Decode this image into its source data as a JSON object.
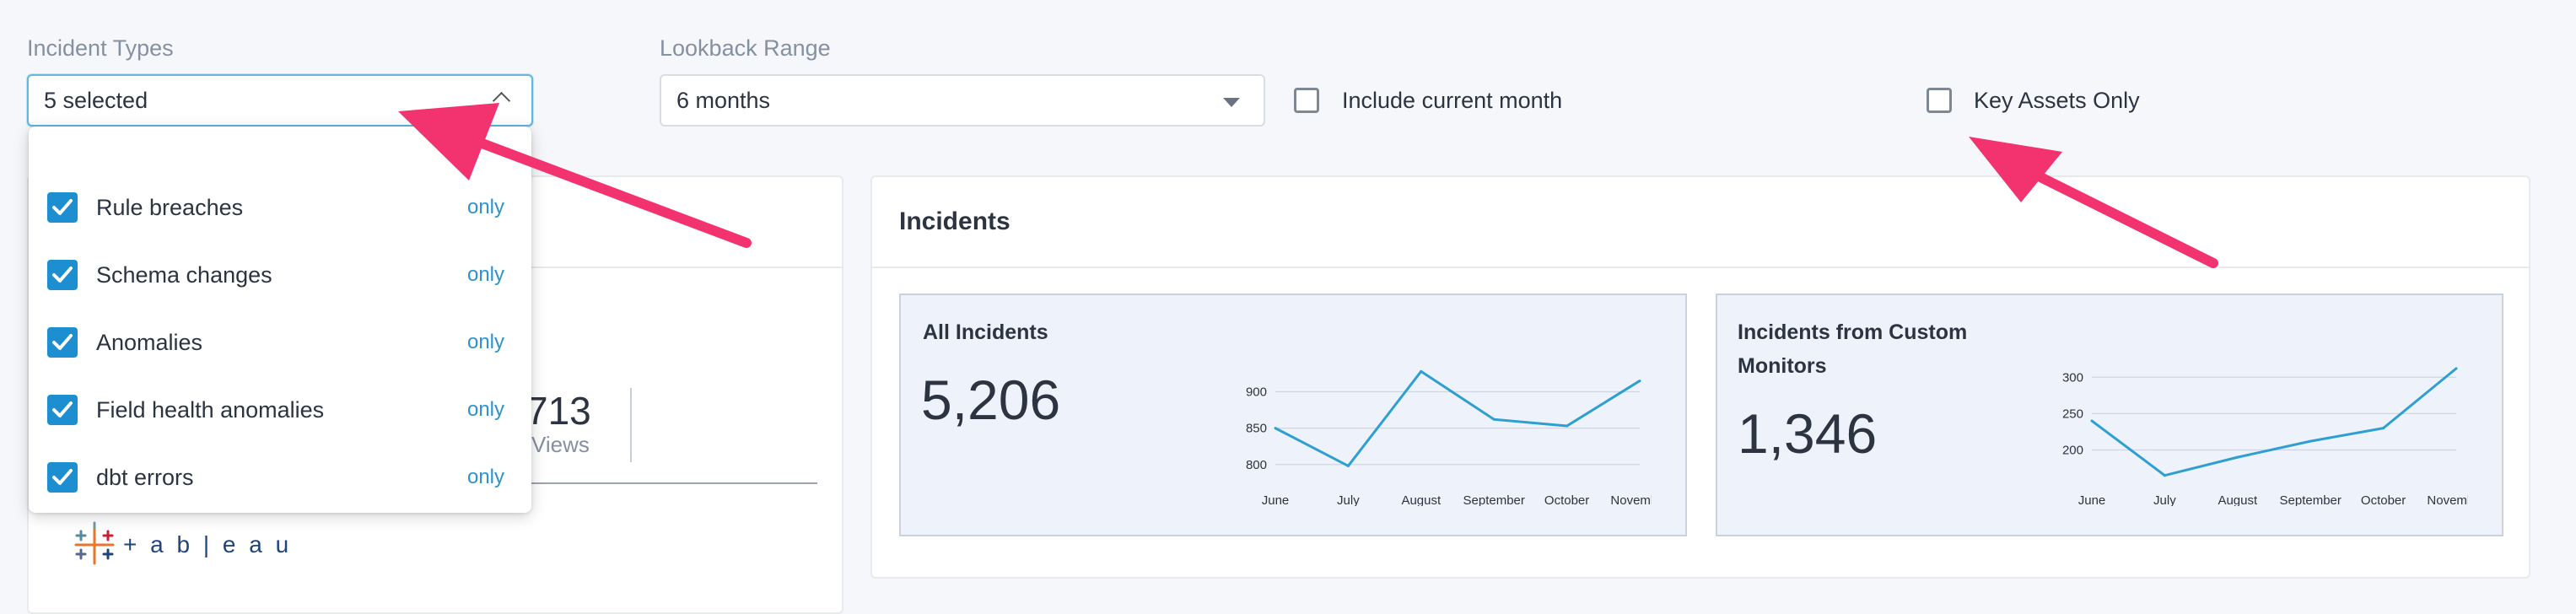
{
  "filters": {
    "incident_types": {
      "label": "Incident Types",
      "value": "5 selected"
    },
    "lookback_range": {
      "label": "Lookback Range",
      "value": "6 months"
    },
    "include_current_month": {
      "label": "Include current month",
      "checked": false
    },
    "key_assets_only": {
      "label": "Key Assets Only",
      "checked": false
    }
  },
  "dropdown": {
    "only_label": "only",
    "options": [
      {
        "label": "Rule breaches",
        "checked": true
      },
      {
        "label": "Schema changes",
        "checked": true
      },
      {
        "label": "Anomalies",
        "checked": true
      },
      {
        "label": "Field health anomalies",
        "checked": true
      },
      {
        "label": "dbt errors",
        "checked": true
      }
    ]
  },
  "left_panel": {
    "partial_value": "713",
    "partial_label": "Views",
    "logo_text": "+ a b | e a u"
  },
  "incidents": {
    "title": "Incidents",
    "all": {
      "title": "All Incidents",
      "value": "5,206"
    },
    "custom": {
      "title_line1": "Incidents from Custom",
      "title_line2": "Monitors",
      "value": "1,346"
    }
  },
  "colors": {
    "accent": "#1d8fd0",
    "line": "#2f9fd1",
    "arrow": "#f2336f",
    "metric_bg": "#edf2fb"
  },
  "chart_data": [
    {
      "type": "line",
      "title": "",
      "categories": [
        "June",
        "July",
        "August",
        "September",
        "October",
        "November"
      ],
      "values": [
        850,
        798,
        928,
        862,
        853,
        915
      ],
      "ylim": [
        780,
        940
      ],
      "yticks": [
        800,
        850,
        900
      ],
      "grid": true,
      "legend": "none"
    },
    {
      "type": "line",
      "title": "",
      "categories": [
        "June",
        "July",
        "August",
        "September",
        "October",
        "November"
      ],
      "values": [
        240,
        165,
        190,
        212,
        230,
        312
      ],
      "ylim": [
        160,
        320
      ],
      "yticks": [
        200,
        250,
        300
      ],
      "grid": true,
      "legend": "none"
    }
  ]
}
